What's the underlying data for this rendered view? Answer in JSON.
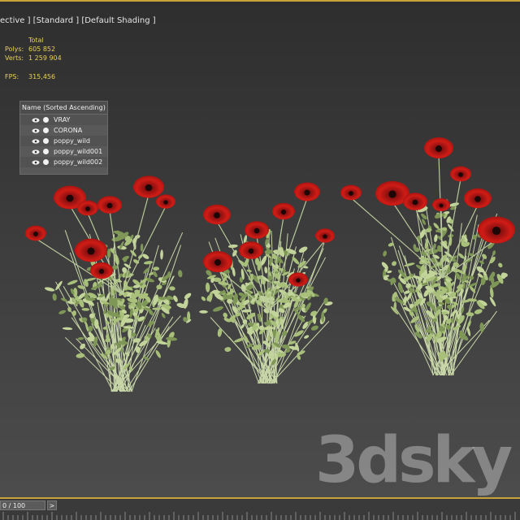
{
  "viewport": {
    "label": "ective ] [Standard ] [Default Shading ]"
  },
  "stats": {
    "header": "Total",
    "polys_label": "Polys:",
    "polys_value": "605 852",
    "verts_label": "Verts:",
    "verts_value": "1 259 904",
    "fps_label": "FPS:",
    "fps_value": "315,456"
  },
  "layers": {
    "header": "Name (Sorted Ascending)",
    "items": [
      {
        "label": "VRAY"
      },
      {
        "label": "CORONA"
      },
      {
        "label": "poppy_wild"
      },
      {
        "label": "poppy_wild001"
      },
      {
        "label": "poppy_wild002"
      }
    ]
  },
  "watermark": "3dsky",
  "timeline": {
    "frame": "0 / 100",
    "next": ">"
  },
  "colors": {
    "accent": "#c8a23a",
    "poppy": "#c41a14",
    "foliage": "#a9c07a"
  }
}
